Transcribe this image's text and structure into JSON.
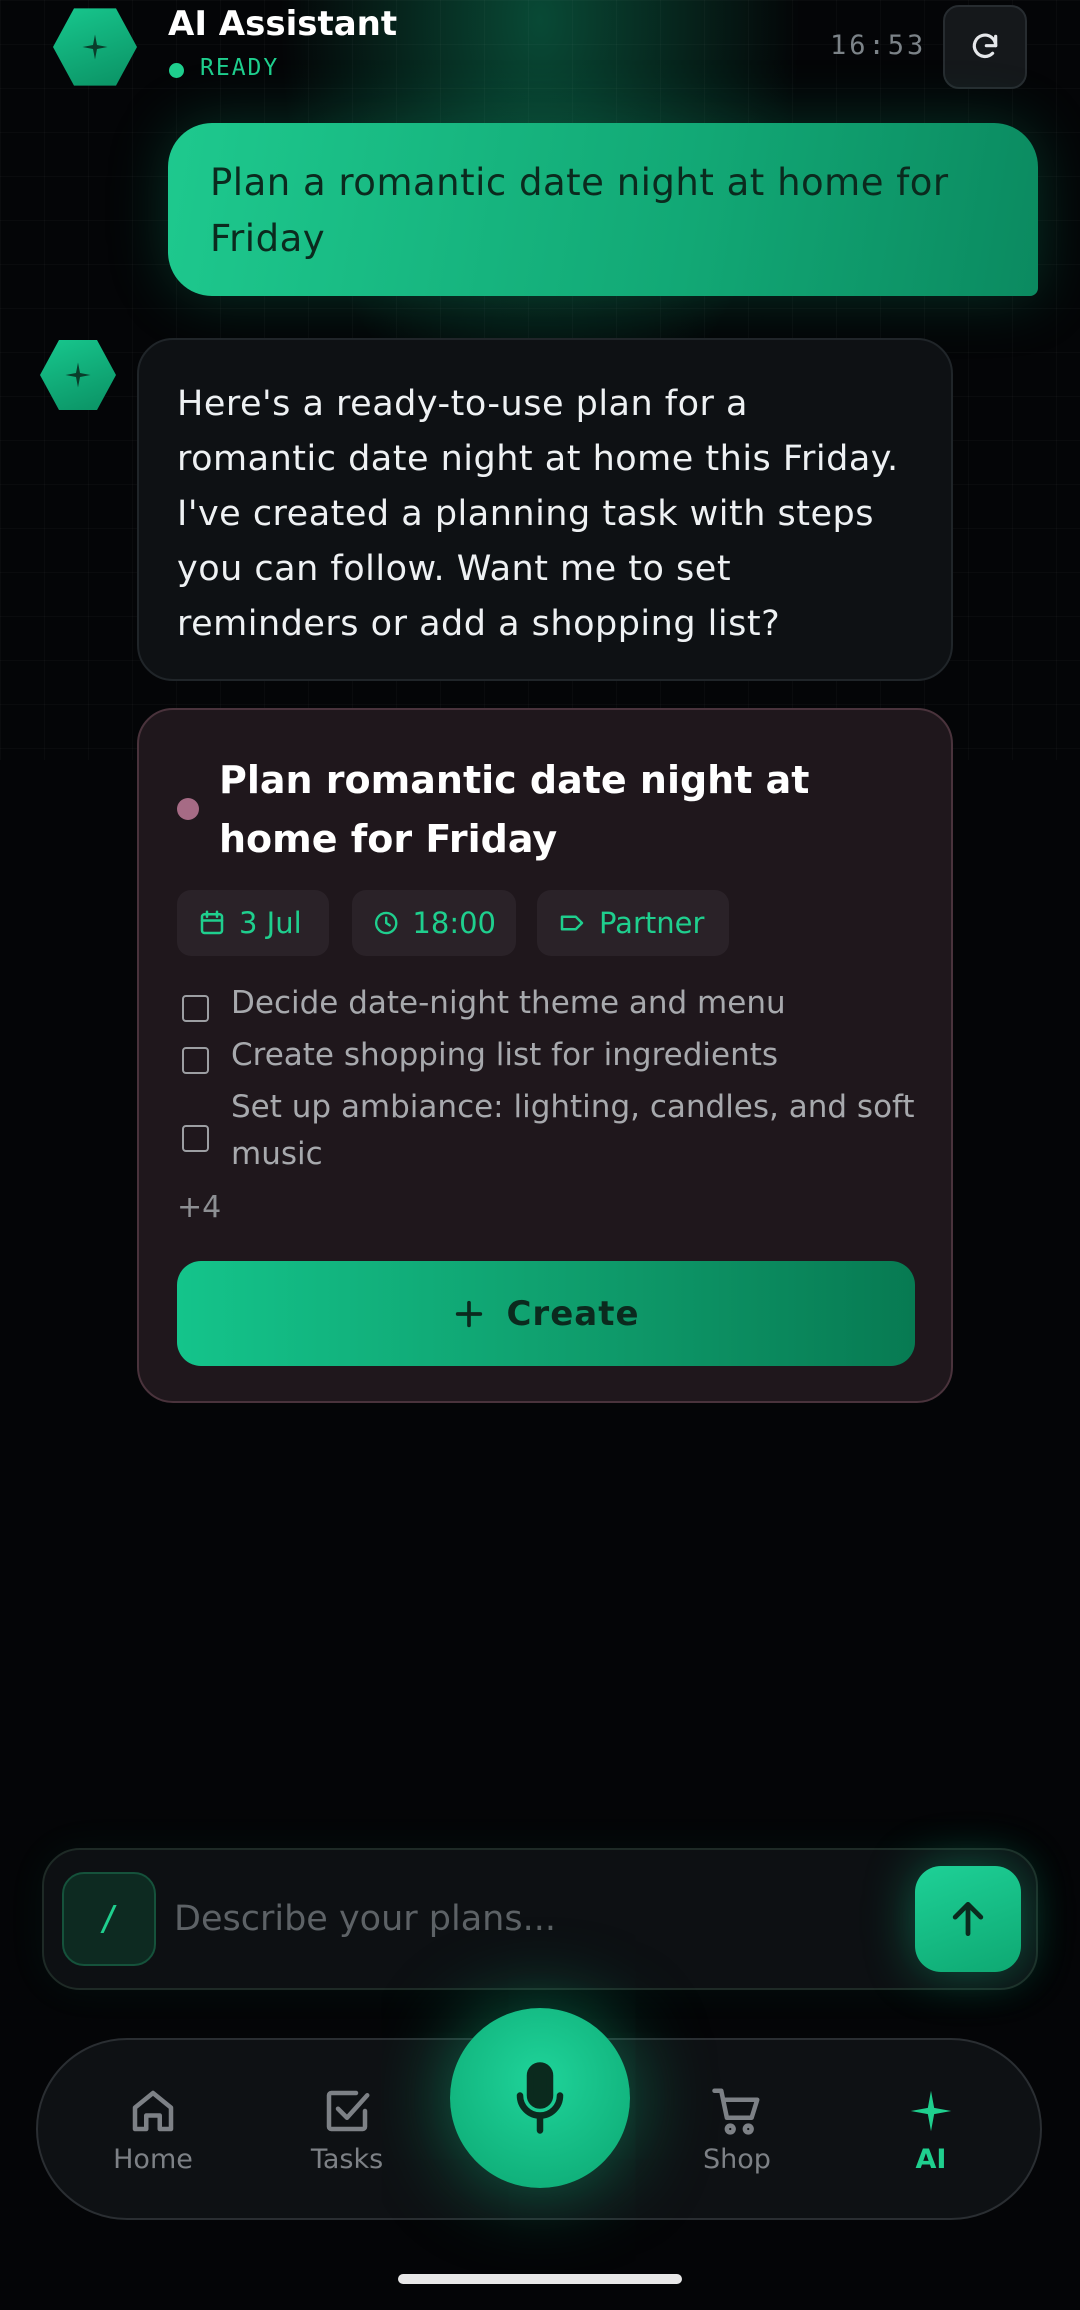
{
  "header": {
    "title": "AI Assistant",
    "status": "READY",
    "time": "16:53",
    "avatar_icon": "sparkle-icon",
    "refresh_icon": "refresh-icon"
  },
  "messages": {
    "user": "Plan a romantic date night at home for Friday",
    "assistant": "Here's a ready-to-use plan for a romantic date night at home this Friday. I've created a planning task with steps you can follow. Want me to set reminders or add a shopping list?"
  },
  "task_card": {
    "title": "Plan romantic date night at home for Friday",
    "date": "3 Jul",
    "time": "18:00",
    "tag": "Partner",
    "checklist": [
      "Decide date-night theme and menu",
      "Create shopping list for ingredients",
      "Set up ambiance: lighting, candles, and soft music"
    ],
    "more": "+4",
    "create_label": "Create"
  },
  "composer": {
    "slash_label": "/",
    "placeholder": "Describe your plans..."
  },
  "nav": {
    "items": [
      {
        "label": "Home",
        "icon": "home-icon"
      },
      {
        "label": "Tasks",
        "icon": "checkbox-icon"
      },
      {
        "label": "Shop",
        "icon": "cart-icon"
      },
      {
        "label": "AI",
        "icon": "sparkle-icon"
      }
    ],
    "mic_icon": "microphone-icon"
  },
  "colors": {
    "accent": "#1fcf8e",
    "background": "#040507",
    "card": "#1f171c",
    "card_border": "#4a333c"
  }
}
